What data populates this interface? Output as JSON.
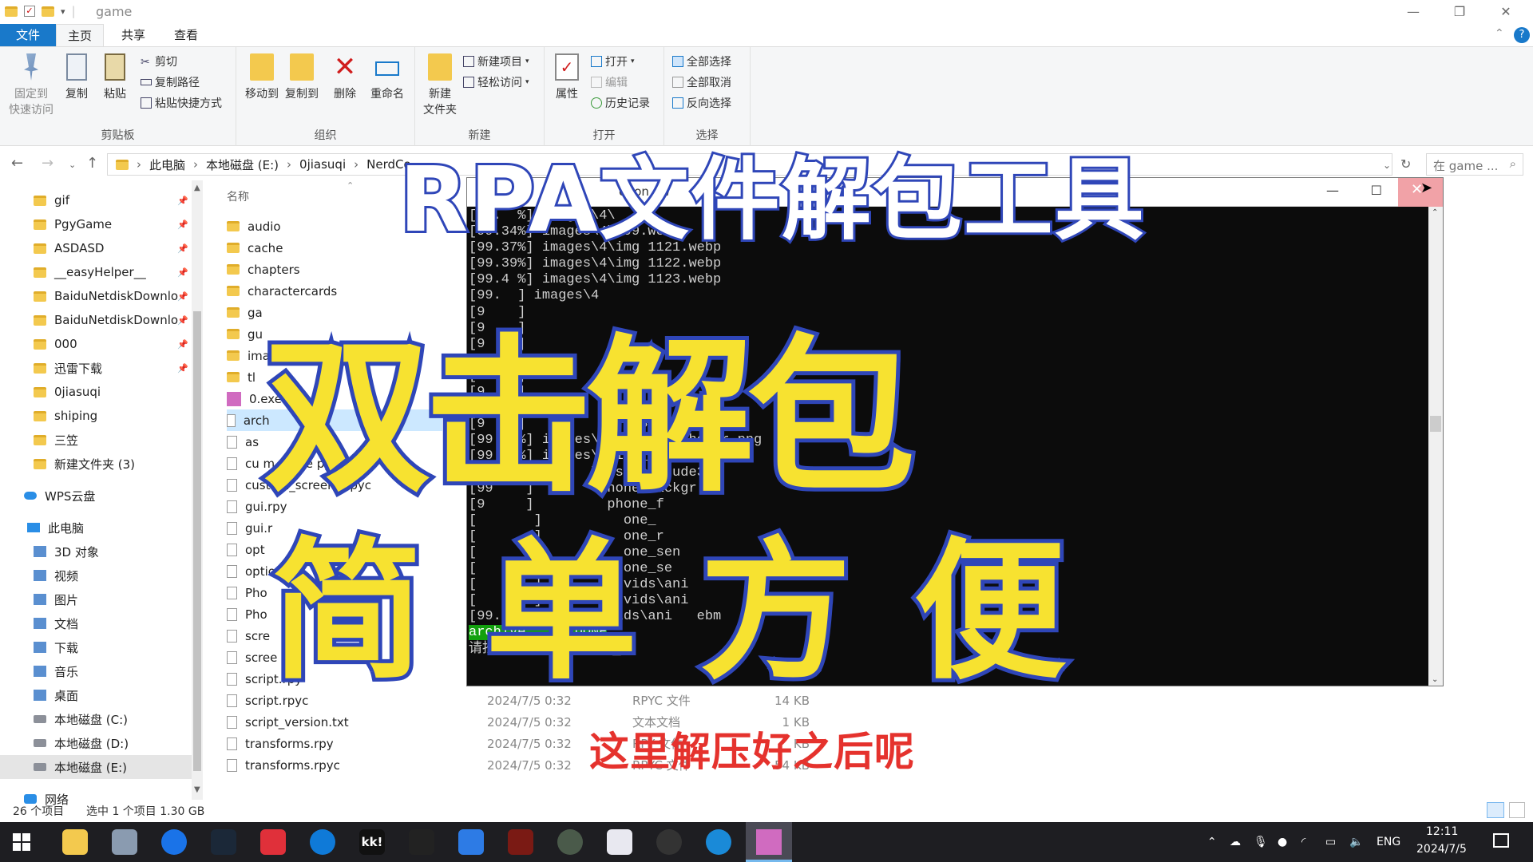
{
  "window": {
    "title": "game",
    "controls": {
      "minimize": "—",
      "maximize": "❐",
      "close": "✕"
    }
  },
  "tabs": [
    "文件",
    "主页",
    "共享",
    "查看"
  ],
  "ribbon": {
    "clipboard": {
      "label": "剪贴板",
      "pin": "固定到\n快速访问",
      "pin_l1": "固定到",
      "pin_l2": "快速访问",
      "copy": "复制",
      "paste": "粘贴",
      "cut": "剪切",
      "copy_path": "复制路径",
      "paste_shortcut": "粘贴快捷方式"
    },
    "organize": {
      "label": "组织",
      "move_to": "移动到",
      "copy_to": "复制到",
      "delete": "删除",
      "rename": "重命名"
    },
    "new": {
      "label": "新建",
      "new_folder_l1": "新建",
      "new_folder_l2": "文件夹",
      "new_item": "新建项目",
      "easy_access": "轻松访问"
    },
    "open": {
      "label": "打开",
      "properties": "属性",
      "open": "打开",
      "edit": "编辑",
      "history": "历史记录"
    },
    "select": {
      "label": "选择",
      "select_all": "全部选择",
      "select_none": "全部取消",
      "invert": "反向选择"
    }
  },
  "address": {
    "crumbs": [
      "此电脑",
      "本地磁盘 (E:)",
      "0jiasuqi",
      "NerdCo"
    ],
    "search_placeholder": "在 game ..."
  },
  "nav": {
    "quick": [
      "gif",
      "PgyGame",
      "ASDASD",
      "__easyHelper__",
      "BaiduNetdiskDownlo",
      "BaiduNetdiskDownlo",
      "000",
      "迅雷下载",
      "0jiasuqi",
      "shiping",
      "三笠",
      "新建文件夹 (3)"
    ],
    "wps": "WPS云盘",
    "pc": "此电脑",
    "pc_items": [
      "3D 对象",
      "视频",
      "图片",
      "文档",
      "下载",
      "音乐",
      "桌面",
      "本地磁盘 (C:)",
      "本地磁盘 (D:)",
      "本地磁盘 (E:)"
    ],
    "network": "网络"
  },
  "files": {
    "col_name": "名称",
    "rows": [
      {
        "name": "audio",
        "kind": "folder",
        "date": "",
        "type": "",
        "size": ""
      },
      {
        "name": "cache",
        "kind": "folder",
        "date": "",
        "type": "",
        "size": ""
      },
      {
        "name": "chapters",
        "kind": "folder",
        "date": "",
        "type": "",
        "size": ""
      },
      {
        "name": "charactercards",
        "kind": "folder",
        "date": "",
        "type": "",
        "size": ""
      },
      {
        "name": "ga",
        "kind": "folder",
        "date": "",
        "type": "",
        "size": ""
      },
      {
        "name": "gu",
        "kind": "folder",
        "date": "",
        "type": "",
        "size": ""
      },
      {
        "name": "ima",
        "kind": "folder",
        "date": "",
        "type": "",
        "size": ""
      },
      {
        "name": "tl",
        "kind": "folder",
        "date": "",
        "type": "",
        "size": ""
      },
      {
        "name": "0.exe",
        "kind": "exe",
        "date": "",
        "type": "",
        "size": ""
      },
      {
        "name": "arch",
        "kind": "file",
        "date": "",
        "type": "",
        "size": ""
      },
      {
        "name": "as",
        "kind": "file",
        "date": "",
        "type": "",
        "size": ""
      },
      {
        "name": "cu   m_scree   py",
        "kind": "file",
        "date": "",
        "type": "",
        "size": ""
      },
      {
        "name": "custom_screens.rpyc",
        "kind": "file",
        "date": "",
        "type": "",
        "size": ""
      },
      {
        "name": "gui.rpy",
        "kind": "file",
        "date": "",
        "type": "",
        "size": ""
      },
      {
        "name": "gui.r",
        "kind": "file",
        "date": "",
        "type": "",
        "size": ""
      },
      {
        "name": "opt",
        "kind": "file",
        "date": "",
        "type": "",
        "size": ""
      },
      {
        "name": "optio",
        "kind": "file",
        "date": "",
        "type": "",
        "size": ""
      },
      {
        "name": "Pho",
        "kind": "file",
        "date": "",
        "type": "",
        "size": ""
      },
      {
        "name": "Pho",
        "kind": "file",
        "date": "",
        "type": "",
        "size": ""
      },
      {
        "name": "scre",
        "kind": "file",
        "date": "",
        "type": "",
        "size": ""
      },
      {
        "name": "scree   pyc",
        "kind": "file",
        "date": "",
        "type": "",
        "size": ""
      },
      {
        "name": "script.rpy",
        "kind": "file",
        "date": "",
        "type": "",
        "size": ""
      },
      {
        "name": "script.rpyc",
        "kind": "file",
        "date": "2024/7/5 0:32",
        "type": "RPYC 文件",
        "size": "14 KB"
      },
      {
        "name": "script_version.txt",
        "kind": "file",
        "date": "2024/7/5 0:32",
        "type": "文本文档",
        "size": "1 KB"
      },
      {
        "name": "transforms.rpy",
        "kind": "file",
        "date": "2024/7/5 0:32",
        "type": "RPY 文件",
        "size": "KB"
      },
      {
        "name": "transforms.rpyc",
        "kind": "file",
        "date": "2024/7/5 0:32",
        "type": "RPYC 文件",
        "size": "54 KB"
      }
    ]
  },
  "status": {
    "count": "26 个项目",
    "selected": "选中 1 个项目  1.30 GB"
  },
  "console": {
    "title": "otion    ew",
    "lines": [
      "[99.  %] images\\4\\",
      "[99.34%] images\\4\\d99.webp",
      "[99.37%] images\\4\\img 1121.webp",
      "[99.39%] images\\4\\img 1122.webp",
      "[99.4 %] images\\4\\img 1123.webp",
      "[99.  ] images\\4",
      "[9    ]  ",
      "[9    ]  ",
      "[9    ]  ",
      "[9    ]  ",
      "[9    ]  ",
      "[9    ]  ",
      "[9    ]  ",
      "[9    ]              3",
      "[99.70%] images\\click_game_hover.png",
      "[99.72%] images\\click_game_idle.png",
      "[99.7 %] ima   \\jessica_nude3",
      "[99    ]  im   \\phone_backgr",
      "[9     ]         phone_f",
      "[       ]          one_",
      "[       ]          one_r",
      "[       ]          one_sen",
      "[       ]          one_se",
      "[       ]          vids\\ani",
      "[       ]          vids\\ani",
      "[99.9   ]   ages\\vids\\ani   ebm"
    ],
    "done": "archive.   a DONE",
    "prompt": "请按任意键继续. . . ▂"
  },
  "overlay": {
    "title": "RPA文件解包工具",
    "main1": "双击解包",
    "main2": "简 单 方 便",
    "subtitle": "这里解压好之后呢"
  },
  "taskbar": {
    "lang": "ENG",
    "time": "12:11",
    "date": "2024/7/5"
  },
  "colors": {
    "accent": "#1979ca",
    "overlay_yellow": "#f7e230",
    "overlay_blue": "#2f46b8",
    "subtitle_red": "#e5322d",
    "done_green": "#13a10e"
  }
}
